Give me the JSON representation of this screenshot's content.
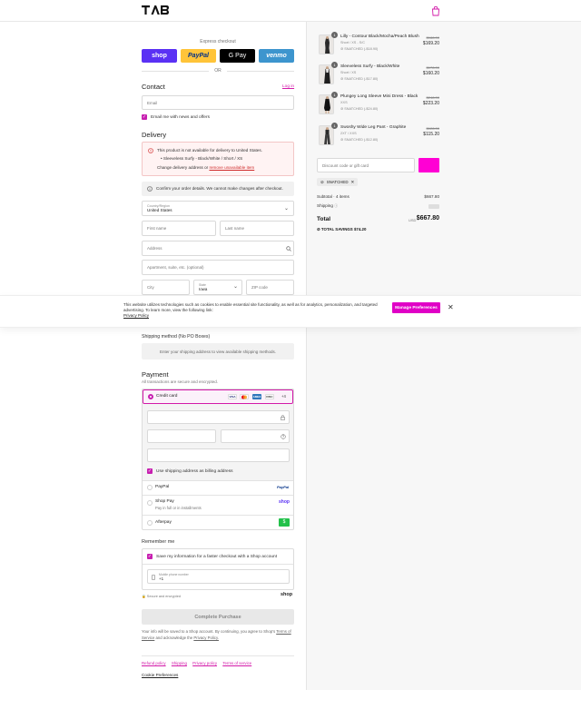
{
  "header": {
    "logo_text": "TAB",
    "cart_icon": "shopping-bag-icon",
    "accent": "#d31aa9"
  },
  "express": {
    "label": "Express checkout",
    "shop": "shop",
    "paypal": "PayPal",
    "gpay": "G Pay",
    "venmo": "venmo",
    "or": "OR"
  },
  "contact": {
    "heading": "Contact",
    "login_link": "Log in",
    "email_placeholder": "Email",
    "news_label": "Email me with news and offers"
  },
  "delivery": {
    "heading": "Delivery",
    "error_title": "This product is not available for delivery to United States.",
    "error_item": "Sleeveless Surfy - Black/White / Short / XS",
    "error_change": "Change delivery address or",
    "error_remove": "remove unavailable item",
    "info": "Confirm your order details. We cannot make changes after checkout.",
    "country_label": "Country/Region",
    "country_value": "United States",
    "first_name": "First name",
    "last_name": "Last name",
    "address": "Address",
    "apartment": "Apartment, suite, etc. (optional)",
    "city": "City",
    "state_label": "State",
    "state_value": "Iowa",
    "zip": "ZIP code"
  },
  "cookie": {
    "text": "This website utilizes technologies such as cookies to enable essential site functionality, as well as for analytics, personalization, and targeted advertising. To learn more, view the following link:",
    "policy": "Privacy Policy",
    "button": "Manage Preferences",
    "close": "✕"
  },
  "shipping": {
    "heading": "Shipping method (No PO Boxes)",
    "message": "Enter your shipping address to view available shipping methods."
  },
  "payment": {
    "heading": "Payment",
    "subtitle": "All transactions are secure and encrypted.",
    "credit_card": "Credit card",
    "card_logos": [
      "VISA",
      "MC",
      "AMEX",
      "DISC"
    ],
    "more_cards": "+4",
    "billing_label": "Use shipping address as billing address",
    "paypal": "PayPal",
    "paypal_logo": "PayPal",
    "shop_pay": "Shop Pay",
    "shop_pay_sub": "Pay in full or in installments",
    "shop_logo": "shop",
    "afterpay": "Afterpay",
    "afterpay_logo": "$"
  },
  "remember": {
    "heading": "Remember me",
    "save_label": "Save my information for a faster checkout with a Shop account",
    "phone_label": "Mobile phone number",
    "phone_value": "+1",
    "secure": "Secure and encrypted",
    "shop_logo": "shop"
  },
  "complete": {
    "button": "Complete Purchase",
    "terms_1": "Your info will be saved to a Shop account. By continuing, you agree to Shop's",
    "terms_link": "Terms of Service",
    "terms_2": "and acknowledge the",
    "privacy_link": "Privacy Policy."
  },
  "footer": {
    "links": [
      "Refund policy",
      "Shipping",
      "Privacy policy",
      "Terms of service"
    ],
    "cookie_prefs": "Cookie Preferences"
  },
  "cart": {
    "items": [
      {
        "name": "Lilly - Contour Black/Mocha/Peach Blush",
        "variant": "Short / XS - S/C",
        "discount": "SNATCHED (-$18.90)",
        "old_price": "$188.00",
        "price": "$169.20",
        "qty": "1"
      },
      {
        "name": "Sleeveless Surfy - Black/White",
        "variant": "Short / XS",
        "discount": "SNATCHED (-$17.80)",
        "old_price": "$178.00",
        "price": "$160.20",
        "qty": "1"
      },
      {
        "name": "Plungey Long Sleeve Mini Dress - Black",
        "variant": "XXS",
        "discount": "SNATCHED (-$24.80)",
        "old_price": "$248.00",
        "price": "$223.20",
        "qty": "1"
      },
      {
        "name": "Swoshy Wide Leg Pant - Graphite",
        "variant": "2XT / XXS",
        "discount": "SNATCHED (-$12.80)",
        "old_price": "$128.00",
        "price": "$115.20",
        "qty": "1"
      }
    ],
    "discount_placeholder": "Discount code or gift card",
    "applied_code": "SNATCHED",
    "subtotal_label": "Subtotal · 4 items",
    "subtotal_value": "$667.80",
    "shipping_label": "Shipping",
    "total_label": "Total",
    "currency": "USD",
    "total_value": "$667.80",
    "savings_label": "TOTAL SAVINGS",
    "savings_value": "$74.20"
  }
}
